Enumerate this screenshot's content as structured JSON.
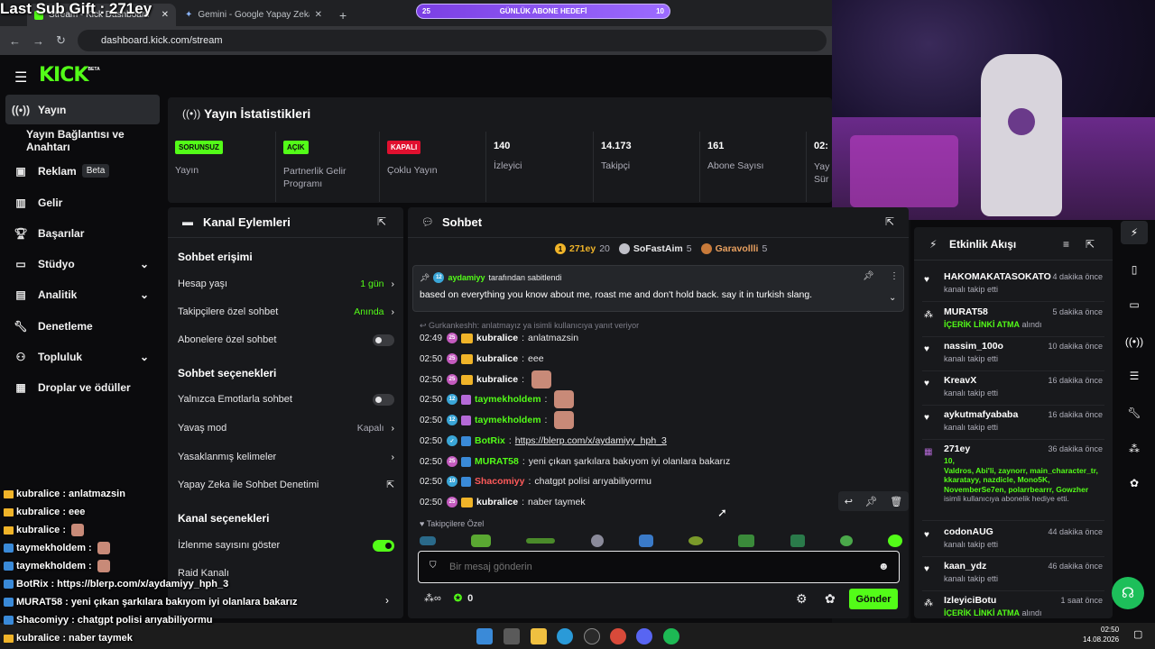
{
  "stream_overlay": {
    "last_sub_gift": "Last Sub Gift : 271ey",
    "goal": {
      "start": "25",
      "label": "GÜNLÜK ABONE HEDEFİ",
      "end": "10",
      "progress": 0.0
    }
  },
  "browser": {
    "tabs": [
      {
        "label": "Stream - Kick Dashboard"
      },
      {
        "label": "Gemini - Google Yapay Zeka'ya de"
      }
    ],
    "new_tab": "+",
    "url": "dashboard.kick.com/stream"
  },
  "brand": {
    "logo": "KICK",
    "logo_sup": "BETA",
    "accent": "#53fc18"
  },
  "sidebar": {
    "items": [
      {
        "label": "Yayın",
        "icon": "broadcast-icon"
      },
      {
        "label": "Yayın Bağlantısı ve Anahtarı"
      },
      {
        "label": "Reklam",
        "badge": "Beta",
        "icon": "ad-icon"
      },
      {
        "label": "Gelir",
        "icon": "revenue-icon"
      },
      {
        "label": "Başarılar",
        "icon": "trophy-icon"
      },
      {
        "label": "Stüdyo",
        "icon": "studio-icon"
      },
      {
        "label": "Analitik",
        "icon": "analytics-icon"
      },
      {
        "label": "Denetleme",
        "icon": "wrench-icon"
      },
      {
        "label": "Topluluk",
        "icon": "community-icon"
      },
      {
        "label": "Droplar ve ödüller",
        "icon": "drops-icon"
      }
    ]
  },
  "stats": {
    "title": "Yayın İstatistikleri",
    "cards": [
      {
        "badge": "SORUNSUZ",
        "badge_color": "#53fc18",
        "label": "Yayın"
      },
      {
        "badge": "AÇIK",
        "badge_color": "#53fc18",
        "label": "Partnerlik Gelir Programı"
      },
      {
        "badge": "KAPALI",
        "badge_color": "#e0102f",
        "label": "Çoklu Yayın"
      },
      {
        "value": "140",
        "label": "İzleyici"
      },
      {
        "value": "14.173",
        "label": "Takipçi"
      },
      {
        "value": "161",
        "label": "Abone Sayısı"
      },
      {
        "value": "02:",
        "label": "Yay Sür"
      }
    ]
  },
  "channel_actions": {
    "title": "Kanal Eylemleri",
    "chat_access_title": "Sohbet erişimi",
    "chat_access": [
      {
        "label": "Hesap yaşı",
        "value": "1 gün"
      },
      {
        "label": "Takipçilere özel sohbet",
        "value": "Anında"
      },
      {
        "label": "Abonelere özel sohbet",
        "toggle": false
      }
    ],
    "chat_options_title": "Sohbet seçenekleri",
    "chat_options": [
      {
        "label": "Yalnızca Emotlarla sohbet",
        "toggle": false
      },
      {
        "label": "Yavaş mod",
        "value": "Kapalı"
      },
      {
        "label": "Yasaklanmış kelimeler"
      },
      {
        "label": "Yapay Zeka ile Sohbet Denetimi"
      }
    ],
    "channel_options_title": "Kanal seçenekleri",
    "channel_options": [
      {
        "label": "İzlenme sayısını göster",
        "toggle": true
      },
      {
        "label": "Raid Kanalı"
      }
    ]
  },
  "chat": {
    "title": "Sohbet",
    "leaders": [
      {
        "name": "271ey",
        "rank": "1",
        "count": "20"
      },
      {
        "name": "SoFastAim",
        "count": "5"
      },
      {
        "name": "Garavollli",
        "count": "5"
      }
    ],
    "pinned": {
      "by_user": "aydamiyy",
      "by_text": "tarafından sabitlendi",
      "text": "based on everything you know about me, roast me and don't hold back. say it in turkish slang."
    },
    "reply_hint": "Gurkankeshh: anlatmayız ya isimli kullanıcıya yanıt veriyor",
    "messages": [
      {
        "time": "02:49",
        "sub": "25",
        "user": "kubralice",
        "color": "#ffffff",
        "text": "anlatmazsin"
      },
      {
        "time": "02:50",
        "sub": "25",
        "user": "kubralice",
        "color": "#ffffff",
        "text": "eee"
      },
      {
        "time": "02:50",
        "sub": "25",
        "user": "kubralice",
        "color": "#ffffff",
        "text": "",
        "emote": true
      },
      {
        "time": "02:50",
        "sub": "12",
        "user": "taymekholdem",
        "color": "#53fc18",
        "text": "",
        "emote": true
      },
      {
        "time": "02:50",
        "sub": "12",
        "user": "taymekholdem",
        "color": "#53fc18",
        "text": "",
        "emote": true
      },
      {
        "time": "02:50",
        "user": "BotRix",
        "color": "#53fc18",
        "text": "https://blerp.com/x/aydamiyy_hph_3",
        "link": true
      },
      {
        "time": "02:50",
        "sub": "25",
        "user": "MURAT58",
        "color": "#53fc18",
        "text": "yeni çıkan şarkılara bakıyom iyi olanlara bakarız"
      },
      {
        "time": "02:50",
        "sub": "10",
        "user": "Shacomiyy",
        "color": "#ff5a5a",
        "text": "chatgpt polisi arıyabiliyormu"
      },
      {
        "time": "02:50",
        "sub": "25",
        "user": "kubralice",
        "color": "#ffffff",
        "text": "naber taymek"
      }
    ],
    "followers_only": "Takipçilere Özel",
    "input_placeholder": "Bir mesaj gönderin",
    "points": "0",
    "send": "Gönder"
  },
  "activity": {
    "title": "Etkinlik Akışı",
    "items": [
      {
        "user": "HAKOMAKATASOKATO",
        "time": "4 dakika önce",
        "desc": "kanalı takip etti",
        "icon": "heart-icon"
      },
      {
        "user": "MURAT58",
        "time": "5 dakika önce",
        "desc_highlight": "İÇERİK LİNKİ ATMA",
        "desc": "alındı",
        "icon": "points-icon"
      },
      {
        "user": "nassim_100o",
        "time": "10 dakika önce",
        "desc": "kanalı takip etti",
        "icon": "heart-icon"
      },
      {
        "user": "KreavX",
        "time": "16 dakika önce",
        "desc": "kanalı takip etti",
        "icon": "heart-icon"
      },
      {
        "user": "aykutmafyababa",
        "time": "16 dakika önce",
        "desc": "kanalı takip etti",
        "icon": "heart-icon"
      },
      {
        "user": "271ey",
        "time": "36 dakika önce",
        "count": "10,",
        "recipients": "Valdros, Abi'li, zaynorr, main_character_tr, kkaratayy, nazdicle, Mono5K, NovemberSe7en, polarrbearrr, Gowzher",
        "desc": "isimli kullanıcıya abonelik hediye etti.",
        "icon": "gift-icon"
      },
      {
        "user": "codonAUG",
        "time": "44 dakika önce",
        "desc": "kanalı takip etti",
        "icon": "heart-icon"
      },
      {
        "user": "kaan_ydz",
        "time": "46 dakika önce",
        "desc": "kanalı takip etti",
        "icon": "heart-icon"
      },
      {
        "user": "IzleyiciBotu",
        "time": "1 saat önce",
        "desc_highlight": "İÇERİK LİNKİ ATMA",
        "desc": "alındı",
        "icon": "points-icon"
      }
    ]
  },
  "overlay_chat": [
    {
      "user": "kubralice",
      "text": "anlatmazsin"
    },
    {
      "user": "kubralice",
      "text": "eee"
    },
    {
      "user": "kubralice",
      "text": ""
    },
    {
      "user": "taymekholdem",
      "text": ""
    },
    {
      "user": "taymekholdem",
      "text": ""
    },
    {
      "user": "BotRix",
      "text": "https://blerp.com/x/aydamiyy_hph_3"
    },
    {
      "user": "MURAT58",
      "text": "yeni çıkan şarkılara bakıyom iyi olanlara bakarız"
    },
    {
      "user": "Shacomiyy",
      "text": "chatgpt polisi arıyabiliyormu"
    },
    {
      "user": "kubralice",
      "text": "naber taymek"
    }
  ],
  "taskbar": {
    "time": "02:50",
    "date": "14.08.2026"
  }
}
